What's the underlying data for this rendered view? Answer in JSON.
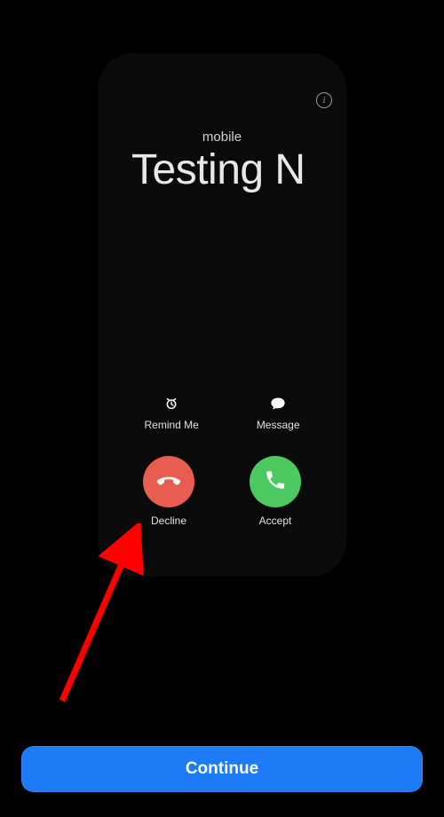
{
  "call": {
    "source_label": "mobile",
    "caller_name": "Testing N"
  },
  "actions": {
    "remind_label": "Remind Me",
    "message_label": "Message",
    "decline_label": "Decline",
    "accept_label": "Accept"
  },
  "footer": {
    "continue_label": "Continue"
  },
  "colors": {
    "decline": "#e85d4f",
    "accept": "#4cc960",
    "continue": "#1d7bf5",
    "arrow": "#ff0000"
  }
}
